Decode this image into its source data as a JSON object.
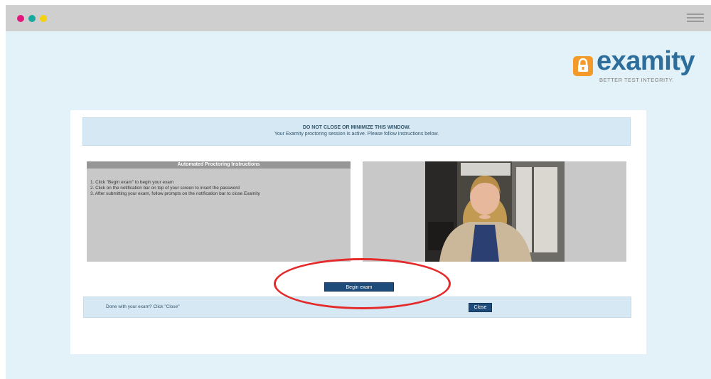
{
  "window": {
    "icons": [
      "close-dot",
      "minimize-dot",
      "maximize-dot",
      "menu-icon"
    ]
  },
  "logo": {
    "name": "examity",
    "registered": "®",
    "tagline": "BETTER TEST INTEGRITY."
  },
  "alert": {
    "title": "DO NOT CLOSE OR MINIMIZE THIS WINDOW.",
    "message": "Your Examity proctoring session is active. Please follow instructions below."
  },
  "instructions": {
    "heading": "Automated Proctoring Instructions",
    "items": [
      "1. Click \"Begin exam\" to begin your exam",
      "2. Click on the notification bar on top of your screen to insert the password",
      "3. After submitting your exam, follow prompts on the notification bar to close Examity"
    ]
  },
  "begin_button": {
    "label": "Begin exam"
  },
  "done_bar": {
    "text": "Done with your exam? Click \"Close\"",
    "close_label": "Close"
  },
  "colors": {
    "accent": "#1f4b7a",
    "brand_orange": "#f39a2b",
    "highlight": "#e42a2a"
  }
}
